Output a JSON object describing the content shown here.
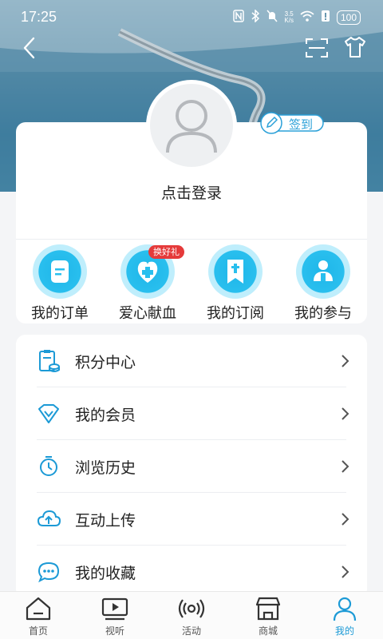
{
  "status_bar": {
    "time": "17:25",
    "net_speed_top": "3.5",
    "net_speed_bottom": "K/s",
    "battery": "100"
  },
  "profile": {
    "login_prompt": "点击登录",
    "signin_label": "签到"
  },
  "quick_actions": [
    {
      "label": "我的订单",
      "icon": "order-icon"
    },
    {
      "label": "爱心献血",
      "icon": "blood-donation-icon",
      "tag": "换好礼"
    },
    {
      "label": "我的订阅",
      "icon": "subscribe-icon"
    },
    {
      "label": "我的参与",
      "icon": "participation-icon"
    }
  ],
  "menu": [
    {
      "label": "积分中心",
      "icon": "points-icon"
    },
    {
      "label": "我的会员",
      "icon": "diamond-icon"
    },
    {
      "label": "浏览历史",
      "icon": "history-clock-icon"
    },
    {
      "label": "互动上传",
      "icon": "cloud-upload-icon"
    },
    {
      "label": "我的收藏",
      "icon": "chat-bubble-icon"
    }
  ],
  "bottom_nav": [
    {
      "label": "首页",
      "icon": "home-icon"
    },
    {
      "label": "视听",
      "icon": "video-play-icon"
    },
    {
      "label": "活动",
      "icon": "broadcast-icon"
    },
    {
      "label": "商城",
      "icon": "store-icon"
    },
    {
      "label": "我的",
      "icon": "person-icon",
      "active": true
    }
  ],
  "colors": {
    "accent": "#1c9ad6",
    "icon_circle": "#29bfee",
    "tag_red": "#e53a3a"
  }
}
